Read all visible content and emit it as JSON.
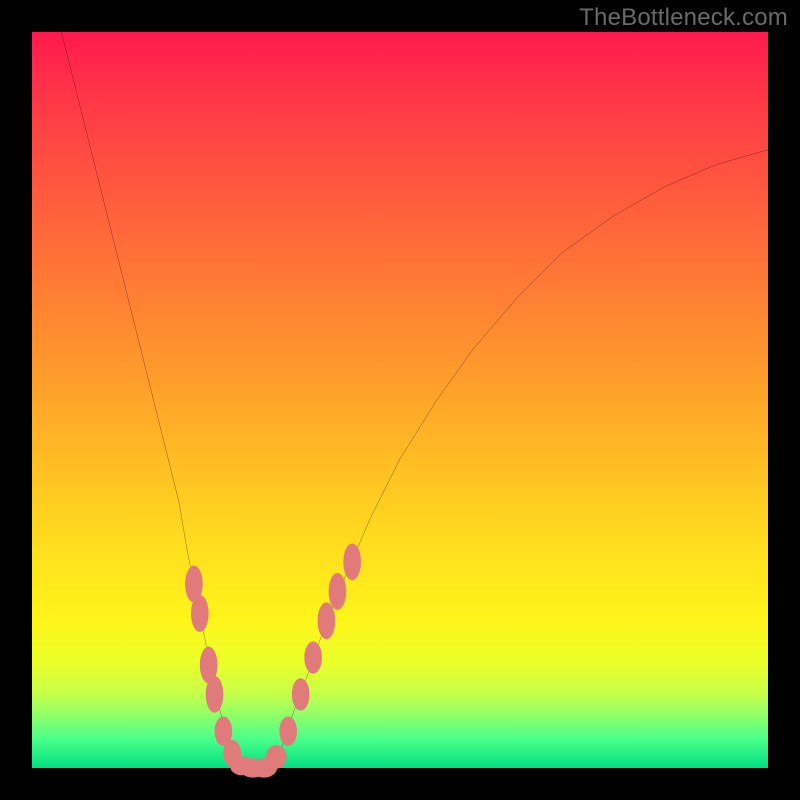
{
  "watermark": "TheBottleneck.com",
  "chart_data": {
    "type": "line",
    "title": "",
    "xlabel": "",
    "ylabel": "",
    "xlim": [
      0,
      100
    ],
    "ylim": [
      0,
      100
    ],
    "grid": false,
    "curve": {
      "name": "bottleneck-curve",
      "color": "#000000",
      "points": [
        {
          "x": 4,
          "y": 100
        },
        {
          "x": 6,
          "y": 92
        },
        {
          "x": 8,
          "y": 84
        },
        {
          "x": 10,
          "y": 76
        },
        {
          "x": 12,
          "y": 68
        },
        {
          "x": 14,
          "y": 60
        },
        {
          "x": 16,
          "y": 52
        },
        {
          "x": 18,
          "y": 44
        },
        {
          "x": 20,
          "y": 36
        },
        {
          "x": 21,
          "y": 30
        },
        {
          "x": 22,
          "y": 25
        },
        {
          "x": 23,
          "y": 20
        },
        {
          "x": 24,
          "y": 15
        },
        {
          "x": 25,
          "y": 10
        },
        {
          "x": 26,
          "y": 6
        },
        {
          "x": 27,
          "y": 3
        },
        {
          "x": 28,
          "y": 1
        },
        {
          "x": 29,
          "y": 0
        },
        {
          "x": 30,
          "y": 0
        },
        {
          "x": 31,
          "y": 0
        },
        {
          "x": 32,
          "y": 0
        },
        {
          "x": 33,
          "y": 1
        },
        {
          "x": 34,
          "y": 3
        },
        {
          "x": 35,
          "y": 6
        },
        {
          "x": 36,
          "y": 9
        },
        {
          "x": 38,
          "y": 14
        },
        {
          "x": 40,
          "y": 20
        },
        {
          "x": 43,
          "y": 27
        },
        {
          "x": 46,
          "y": 34
        },
        {
          "x": 50,
          "y": 42
        },
        {
          "x": 55,
          "y": 50
        },
        {
          "x": 60,
          "y": 57
        },
        {
          "x": 66,
          "y": 64
        },
        {
          "x": 72,
          "y": 70
        },
        {
          "x": 79,
          "y": 75
        },
        {
          "x": 86,
          "y": 79
        },
        {
          "x": 93,
          "y": 82
        },
        {
          "x": 100,
          "y": 84
        }
      ]
    },
    "markers": {
      "name": "highlight-markers",
      "color": "#e17a7a",
      "points": [
        {
          "x": 22.0,
          "y": 25,
          "rx": 1.2,
          "ry": 2.5
        },
        {
          "x": 22.8,
          "y": 21,
          "rx": 1.2,
          "ry": 2.5
        },
        {
          "x": 24.0,
          "y": 14,
          "rx": 1.2,
          "ry": 2.5
        },
        {
          "x": 24.8,
          "y": 10,
          "rx": 1.2,
          "ry": 2.5
        },
        {
          "x": 26.0,
          "y": 5,
          "rx": 1.2,
          "ry": 2.0
        },
        {
          "x": 27.2,
          "y": 2,
          "rx": 1.2,
          "ry": 1.8
        },
        {
          "x": 28.5,
          "y": 0.3,
          "rx": 1.6,
          "ry": 1.3
        },
        {
          "x": 30.0,
          "y": 0.0,
          "rx": 1.8,
          "ry": 1.3
        },
        {
          "x": 31.5,
          "y": 0.0,
          "rx": 1.8,
          "ry": 1.3
        },
        {
          "x": 33.2,
          "y": 1.5,
          "rx": 1.4,
          "ry": 1.6
        },
        {
          "x": 34.8,
          "y": 5,
          "rx": 1.2,
          "ry": 2.0
        },
        {
          "x": 36.5,
          "y": 10,
          "rx": 1.2,
          "ry": 2.2
        },
        {
          "x": 38.2,
          "y": 15,
          "rx": 1.2,
          "ry": 2.2
        },
        {
          "x": 40.0,
          "y": 20,
          "rx": 1.2,
          "ry": 2.5
        },
        {
          "x": 41.5,
          "y": 24,
          "rx": 1.2,
          "ry": 2.5
        },
        {
          "x": 43.5,
          "y": 28,
          "rx": 1.2,
          "ry": 2.5
        }
      ]
    }
  }
}
